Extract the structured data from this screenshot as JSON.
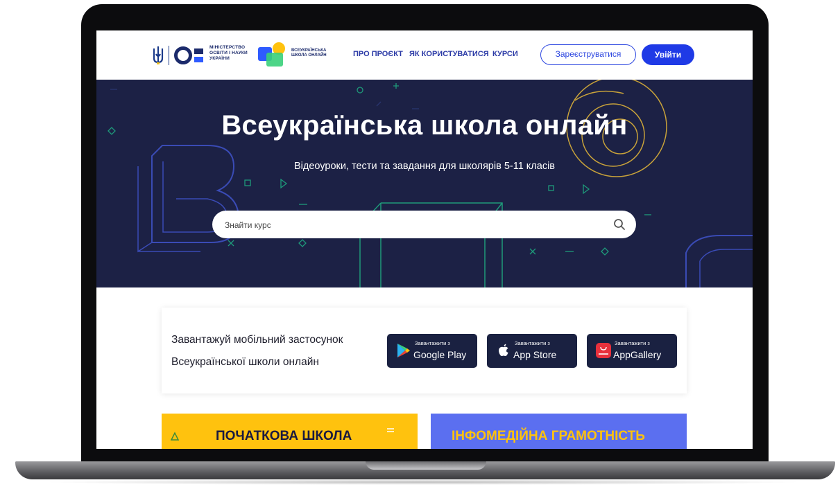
{
  "header": {
    "ministry_logo_text": "МІНІСТЕРСТВО ОСВІТИ І НАУКИ УКРАЇНИ",
    "school_logo_text": "ВСЕУКРАЇНСЬКА ШКОЛА ОНЛАЙН",
    "nav": [
      "ПРО ПРОЄКТ",
      "ЯК КОРИСТУВАТИСЯ",
      "КУРСИ"
    ],
    "register_label": "Зареєструватися",
    "login_label": "Увійти"
  },
  "hero": {
    "title": "Всеукраїнська школа онлайн",
    "subtitle": "Відеоуроки, тести та завдання для школярів 5-11 класів",
    "search_placeholder": "Знайти курс"
  },
  "app_banner": {
    "line1": "Завантажуй мобільний застосунок",
    "line2": "Всеукраїнської школи онлайн",
    "stores": [
      {
        "small": "Завантажити з",
        "name": "Google Play",
        "icon": "google-play-icon"
      },
      {
        "small": "Завантажити з",
        "name": "App Store",
        "icon": "apple-icon"
      },
      {
        "small": "Завантажити з",
        "name": "AppGallery",
        "icon": "huawei-icon"
      }
    ]
  },
  "tiles": [
    {
      "label": "ПОЧАТКОВА ШКОЛА",
      "color": "#ffc20e"
    },
    {
      "label": "ІНФОМЕДІЙНА ГРАМОТНІСТЬ",
      "color": "#5b6ff0"
    }
  ],
  "colors": {
    "brand_blue": "#1f3ae6",
    "hero_bg": "#1c2145",
    "accent_yellow": "#ffc20e"
  }
}
